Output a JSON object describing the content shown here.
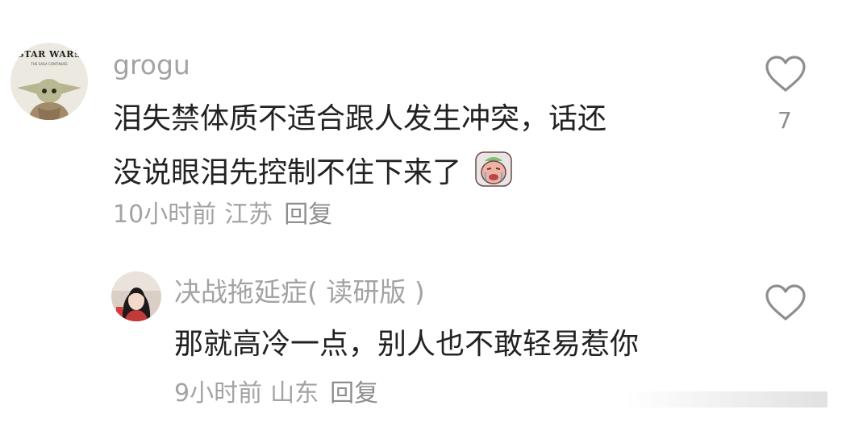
{
  "comments": [
    {
      "username": "grogu",
      "avatar_icon": "grogu-star-wars-avatar",
      "avatar_text": {
        "brand": "STAR WARS",
        "sub": "THE SAGA CONTINUES"
      },
      "text_line1": "泪失禁体质不适合跟人发生冲突，话还",
      "text_line2": "没说眼泪先控制不住下来了",
      "emoji": "crying-face-emoji",
      "time": "10小时前",
      "location": "江苏",
      "reply_label": "回复",
      "like_count": "7",
      "like_icon": "heart-outline-icon"
    },
    {
      "username": "决战拖延症( 读研版 )",
      "avatar_icon": "girl-portrait-avatar",
      "text": "那就高冷一点，别人也不敢轻易惹你",
      "time": "9小时前",
      "location": "山东",
      "reply_label": "回复",
      "like_icon": "heart-outline-icon"
    }
  ],
  "colors": {
    "text": "#222222",
    "meta": "#a3a3a3",
    "icon": "#8e8e8e"
  }
}
